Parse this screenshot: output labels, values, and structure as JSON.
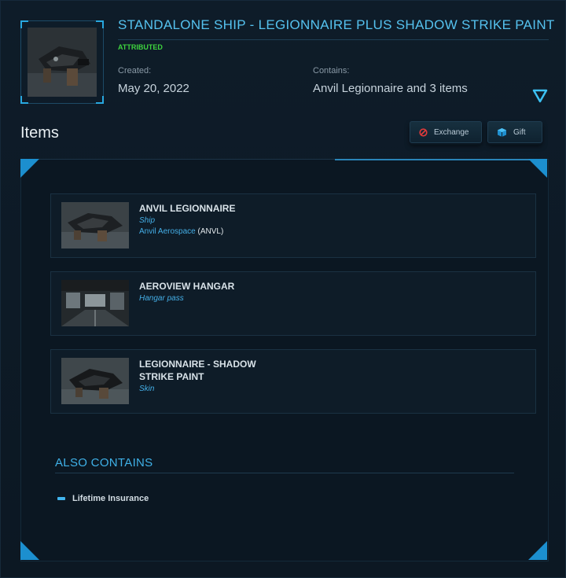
{
  "header": {
    "title": "STANDALONE SHIP - LEGIONNAIRE PLUS SHADOW STRIKE PAINT",
    "status_badge": "ATTRIBUTED",
    "created_label": "Created:",
    "created_value": "May 20, 2022",
    "contains_label": "Contains:",
    "contains_value": "Anvil Legionnaire and 3 items",
    "expand_icon": "triangle-down-icon"
  },
  "items_section": {
    "title": "Items",
    "buttons": {
      "exchange_label": "Exchange",
      "exchange_icon": "block-icon",
      "gift_label": "Gift",
      "gift_icon": "gift-box-icon"
    },
    "list": [
      {
        "name": "ANVIL LEGIONNAIRE",
        "type": "Ship",
        "manufacturer": "Anvil Aerospace",
        "manufacturer_code": "(ANVL)"
      },
      {
        "name": "AEROVIEW HANGAR",
        "type": "Hangar pass"
      },
      {
        "name": "LEGIONNAIRE - SHADOW STRIKE PAINT",
        "type": "Skin"
      }
    ]
  },
  "also_contains": {
    "title": "ALSO CONTAINS",
    "items": [
      "Lifetime Insurance"
    ]
  },
  "colors": {
    "accent": "#55c2ef",
    "status_green": "#3ed33e",
    "background": "#0d1a26"
  }
}
